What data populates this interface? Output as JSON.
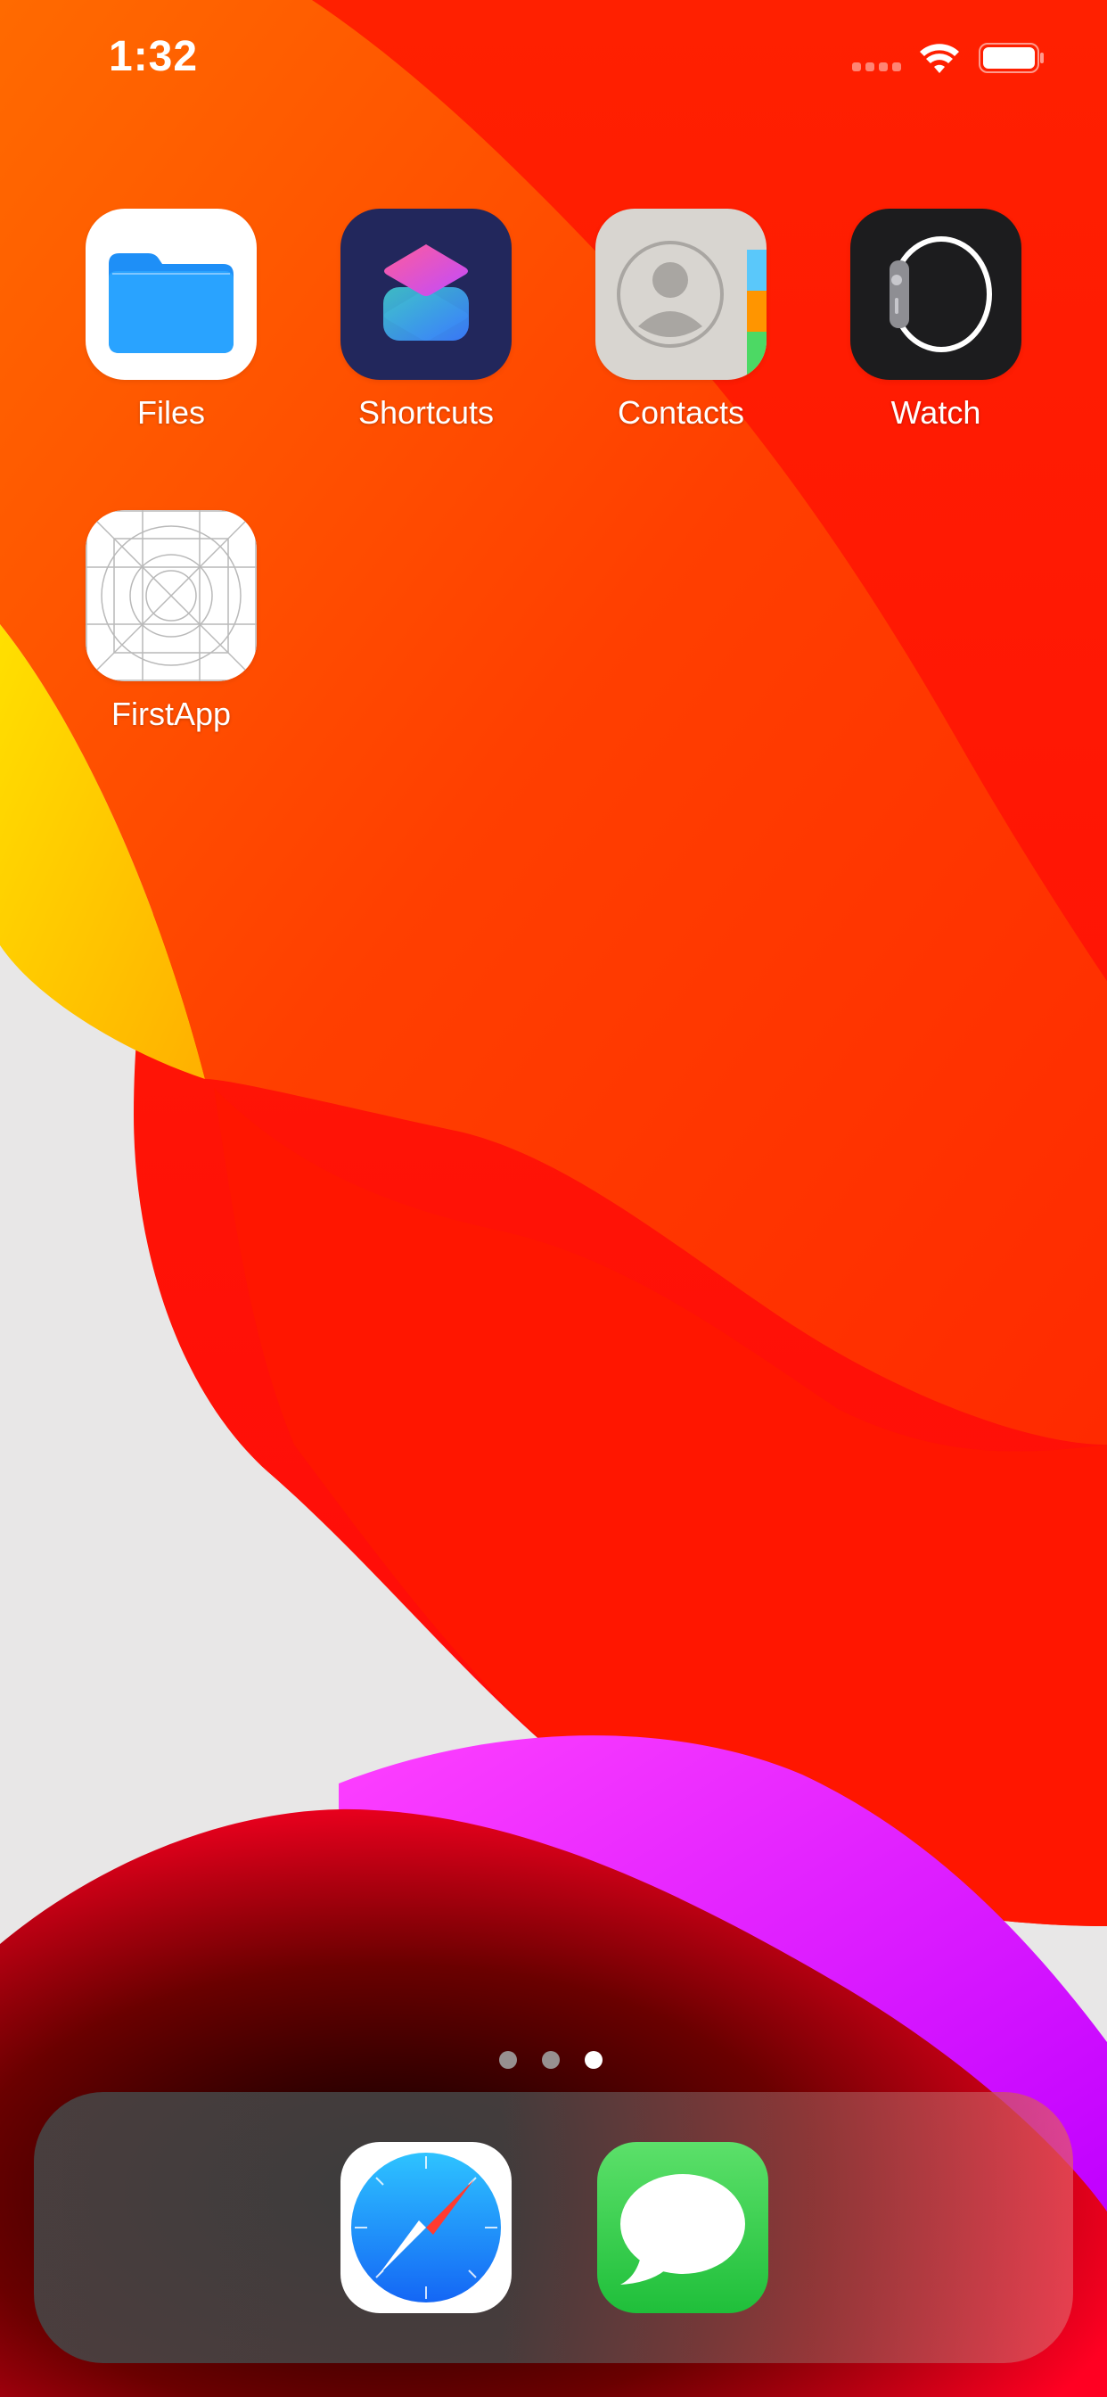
{
  "status_bar": {
    "time": "1:32",
    "icons": [
      "cellular-signal-icon",
      "wifi-icon",
      "battery-icon"
    ]
  },
  "home_screen": {
    "page_count": 3,
    "current_page": 3,
    "apps": [
      {
        "name": "Files",
        "icon": "files-folder-icon"
      },
      {
        "name": "Shortcuts",
        "icon": "shortcuts-icon"
      },
      {
        "name": "Contacts",
        "icon": "contacts-icon"
      },
      {
        "name": "Watch",
        "icon": "watch-icon"
      },
      {
        "name": "FirstApp",
        "icon": "placeholder-grid-icon"
      }
    ]
  },
  "dock": {
    "apps": [
      {
        "name": "Safari",
        "icon": "safari-compass-icon"
      },
      {
        "name": "Messages",
        "icon": "messages-bubble-icon"
      }
    ]
  },
  "colors": {
    "wallpaper_red": "#ff1a00",
    "wallpaper_orange": "#ff4a00",
    "wallpaper_yellow": "#ffd400",
    "wallpaper_magenta": "#d61aff",
    "dot_active": "#ffffff",
    "dot_inactive": "#9a9a9a",
    "files_blue": "#1e8ff7",
    "messages_green": "#33cc4a"
  }
}
